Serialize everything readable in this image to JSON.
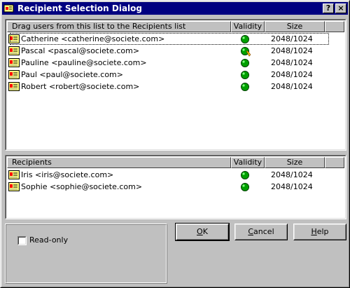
{
  "window": {
    "title": "Recipient Selection Dialog",
    "help_label": "?",
    "close_label": "×"
  },
  "available": {
    "headers": {
      "name": "Drag users from this list to the Recipients list",
      "validity": "Validity",
      "size": "Size"
    },
    "rows": [
      {
        "name": "Catherine <catherine@societe.com>",
        "validity": "valid",
        "size": "2048/1024",
        "focused": true
      },
      {
        "name": "Pascal <pascal@societe.com>",
        "validity": "valid-warning",
        "size": "2048/1024"
      },
      {
        "name": "Pauline <pauline@societe.com>",
        "validity": "valid",
        "size": "2048/1024"
      },
      {
        "name": "Paul <paul@societe.com>",
        "validity": "valid",
        "size": "2048/1024"
      },
      {
        "name": "Robert <robert@societe.com>",
        "validity": "valid",
        "size": "2048/1024"
      }
    ]
  },
  "recipients": {
    "headers": {
      "name": "Recipients",
      "validity": "Validity",
      "size": "Size"
    },
    "rows": [
      {
        "name": "Iris <iris@societe.com>",
        "validity": "valid",
        "size": "2048/1024"
      },
      {
        "name": "Sophie <sophie@societe.com>",
        "validity": "valid",
        "size": "2048/1024"
      }
    ]
  },
  "options": {
    "readonly_label": "Read-only",
    "readonly_checked": false
  },
  "buttons": {
    "ok": "OK",
    "cancel": "Cancel",
    "help": "Help"
  },
  "colors": {
    "title_bar": "#000080",
    "face": "#c0c0c0",
    "status_valid": "#00a000"
  }
}
